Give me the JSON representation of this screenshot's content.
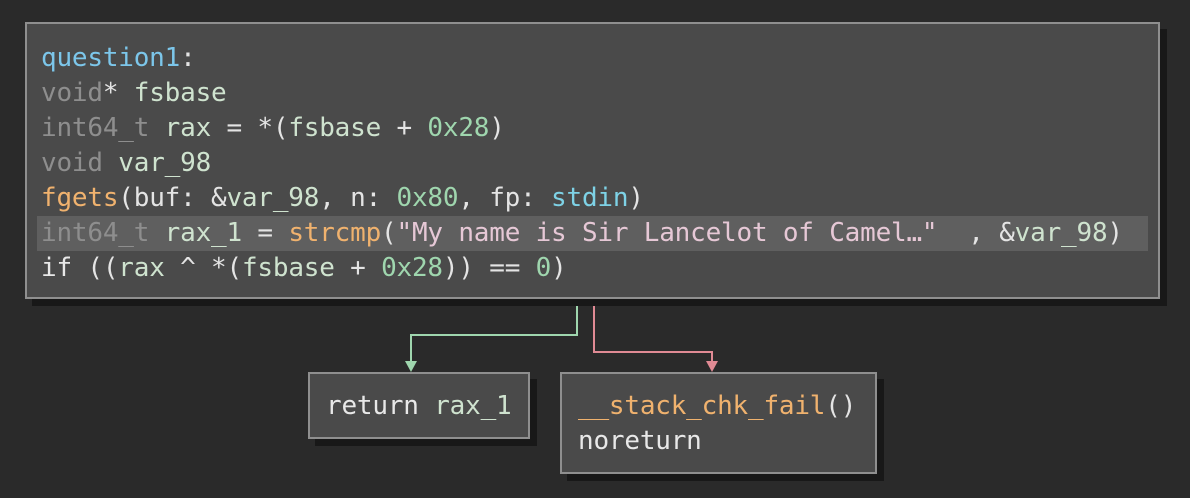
{
  "graph": {
    "edge_colors": {
      "true": "#9fd6ae",
      "false": "#e08a94"
    },
    "blocks": [
      {
        "id": "question1",
        "lines": [
          {
            "tokens": [
              [
                "question1",
                "label"
              ],
              [
                ":",
                "punct"
              ]
            ]
          },
          {
            "tokens": [
              [
                "void",
                "type"
              ],
              [
                "* ",
                "punct"
              ],
              [
                "fsbase",
                "var"
              ]
            ]
          },
          {
            "tokens": [
              [
                "int64_t",
                "type"
              ],
              [
                " ",
                "punct"
              ],
              [
                "rax",
                "var"
              ],
              [
                " = *(",
                "punct"
              ],
              [
                "fsbase",
                "var"
              ],
              [
                " + ",
                "punct"
              ],
              [
                "0x28",
                "num"
              ],
              [
                ")",
                "punct"
              ]
            ]
          },
          {
            "tokens": [
              [
                "void",
                "type"
              ],
              [
                " ",
                "punct"
              ],
              [
                "var_98",
                "var"
              ]
            ]
          },
          {
            "tokens": [
              [
                "fgets",
                "func"
              ],
              [
                "(buf: &",
                "punct"
              ],
              [
                "var_98",
                "var"
              ],
              [
                ", n: ",
                "punct"
              ],
              [
                "0x80",
                "num"
              ],
              [
                ", fp: ",
                "punct"
              ],
              [
                "stdin",
                "sym"
              ],
              [
                ")",
                "punct"
              ]
            ]
          },
          {
            "highlighted": true,
            "tokens": [
              [
                "int64_t",
                "type"
              ],
              [
                " ",
                "punct"
              ],
              [
                "rax_1",
                "var"
              ],
              [
                " = ",
                "punct"
              ],
              [
                "strcmp",
                "func"
              ],
              [
                "(",
                "punct"
              ],
              [
                "\"My name is Sir Lancelot of Camel…\"",
                "str"
              ],
              [
                "  , &",
                "punct"
              ],
              [
                "var_98",
                "var"
              ],
              [
                ")",
                "punct"
              ]
            ]
          },
          {
            "tokens": [
              [
                "if",
                "kw"
              ],
              [
                " ((",
                "punct"
              ],
              [
                "rax",
                "var"
              ],
              [
                " ^ *(",
                "punct"
              ],
              [
                "fsbase",
                "var"
              ],
              [
                " + ",
                "punct"
              ],
              [
                "0x28",
                "num"
              ],
              [
                ")) == ",
                "punct"
              ],
              [
                "0",
                "num"
              ],
              [
                ")",
                "punct"
              ]
            ]
          }
        ]
      },
      {
        "id": "return-block",
        "lines": [
          {
            "tokens": [
              [
                "return",
                "kw"
              ],
              [
                " ",
                "punct"
              ],
              [
                "rax_1",
                "var"
              ]
            ]
          }
        ]
      },
      {
        "id": "stack-chk-fail-block",
        "lines": [
          {
            "tokens": [
              [
                "__stack_chk_fail",
                "func"
              ],
              [
                "()",
                "punct"
              ]
            ]
          },
          {
            "tokens": [
              [
                "noreturn",
                "kw"
              ]
            ]
          }
        ]
      }
    ]
  }
}
